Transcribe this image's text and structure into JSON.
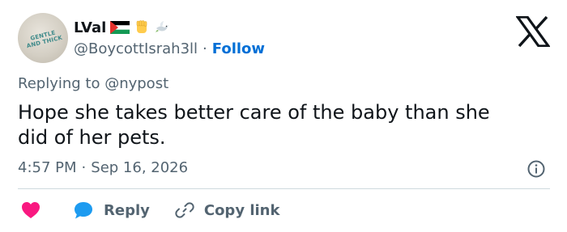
{
  "author": {
    "display_name": "LVal",
    "handle": "@BoycottIsrah3ll",
    "separator": "·",
    "follow_label": "Follow",
    "avatar_text": [
      "GENTLE",
      "AND THICK"
    ]
  },
  "badges": [
    "palestine-flag",
    "raised-fist-emoji",
    "dove-emoji"
  ],
  "reply_to": "Replying to @nypost",
  "tweet": {
    "lines": [
      "Hope she takes better care of the baby than she",
      "did of her pets."
    ]
  },
  "meta": {
    "time": "4:57 PM",
    "separator": "·",
    "date": "Sep 16, 2026"
  },
  "actions": {
    "like_label": "",
    "reply_label": "Reply",
    "copy_link_label": "Copy link"
  },
  "colors": {
    "text": "#0f1419",
    "muted": "#536471",
    "link": "#006fd6",
    "like": "#f91880",
    "reply_bubble": "#1d9bf0",
    "divider": "#cfd9de"
  }
}
